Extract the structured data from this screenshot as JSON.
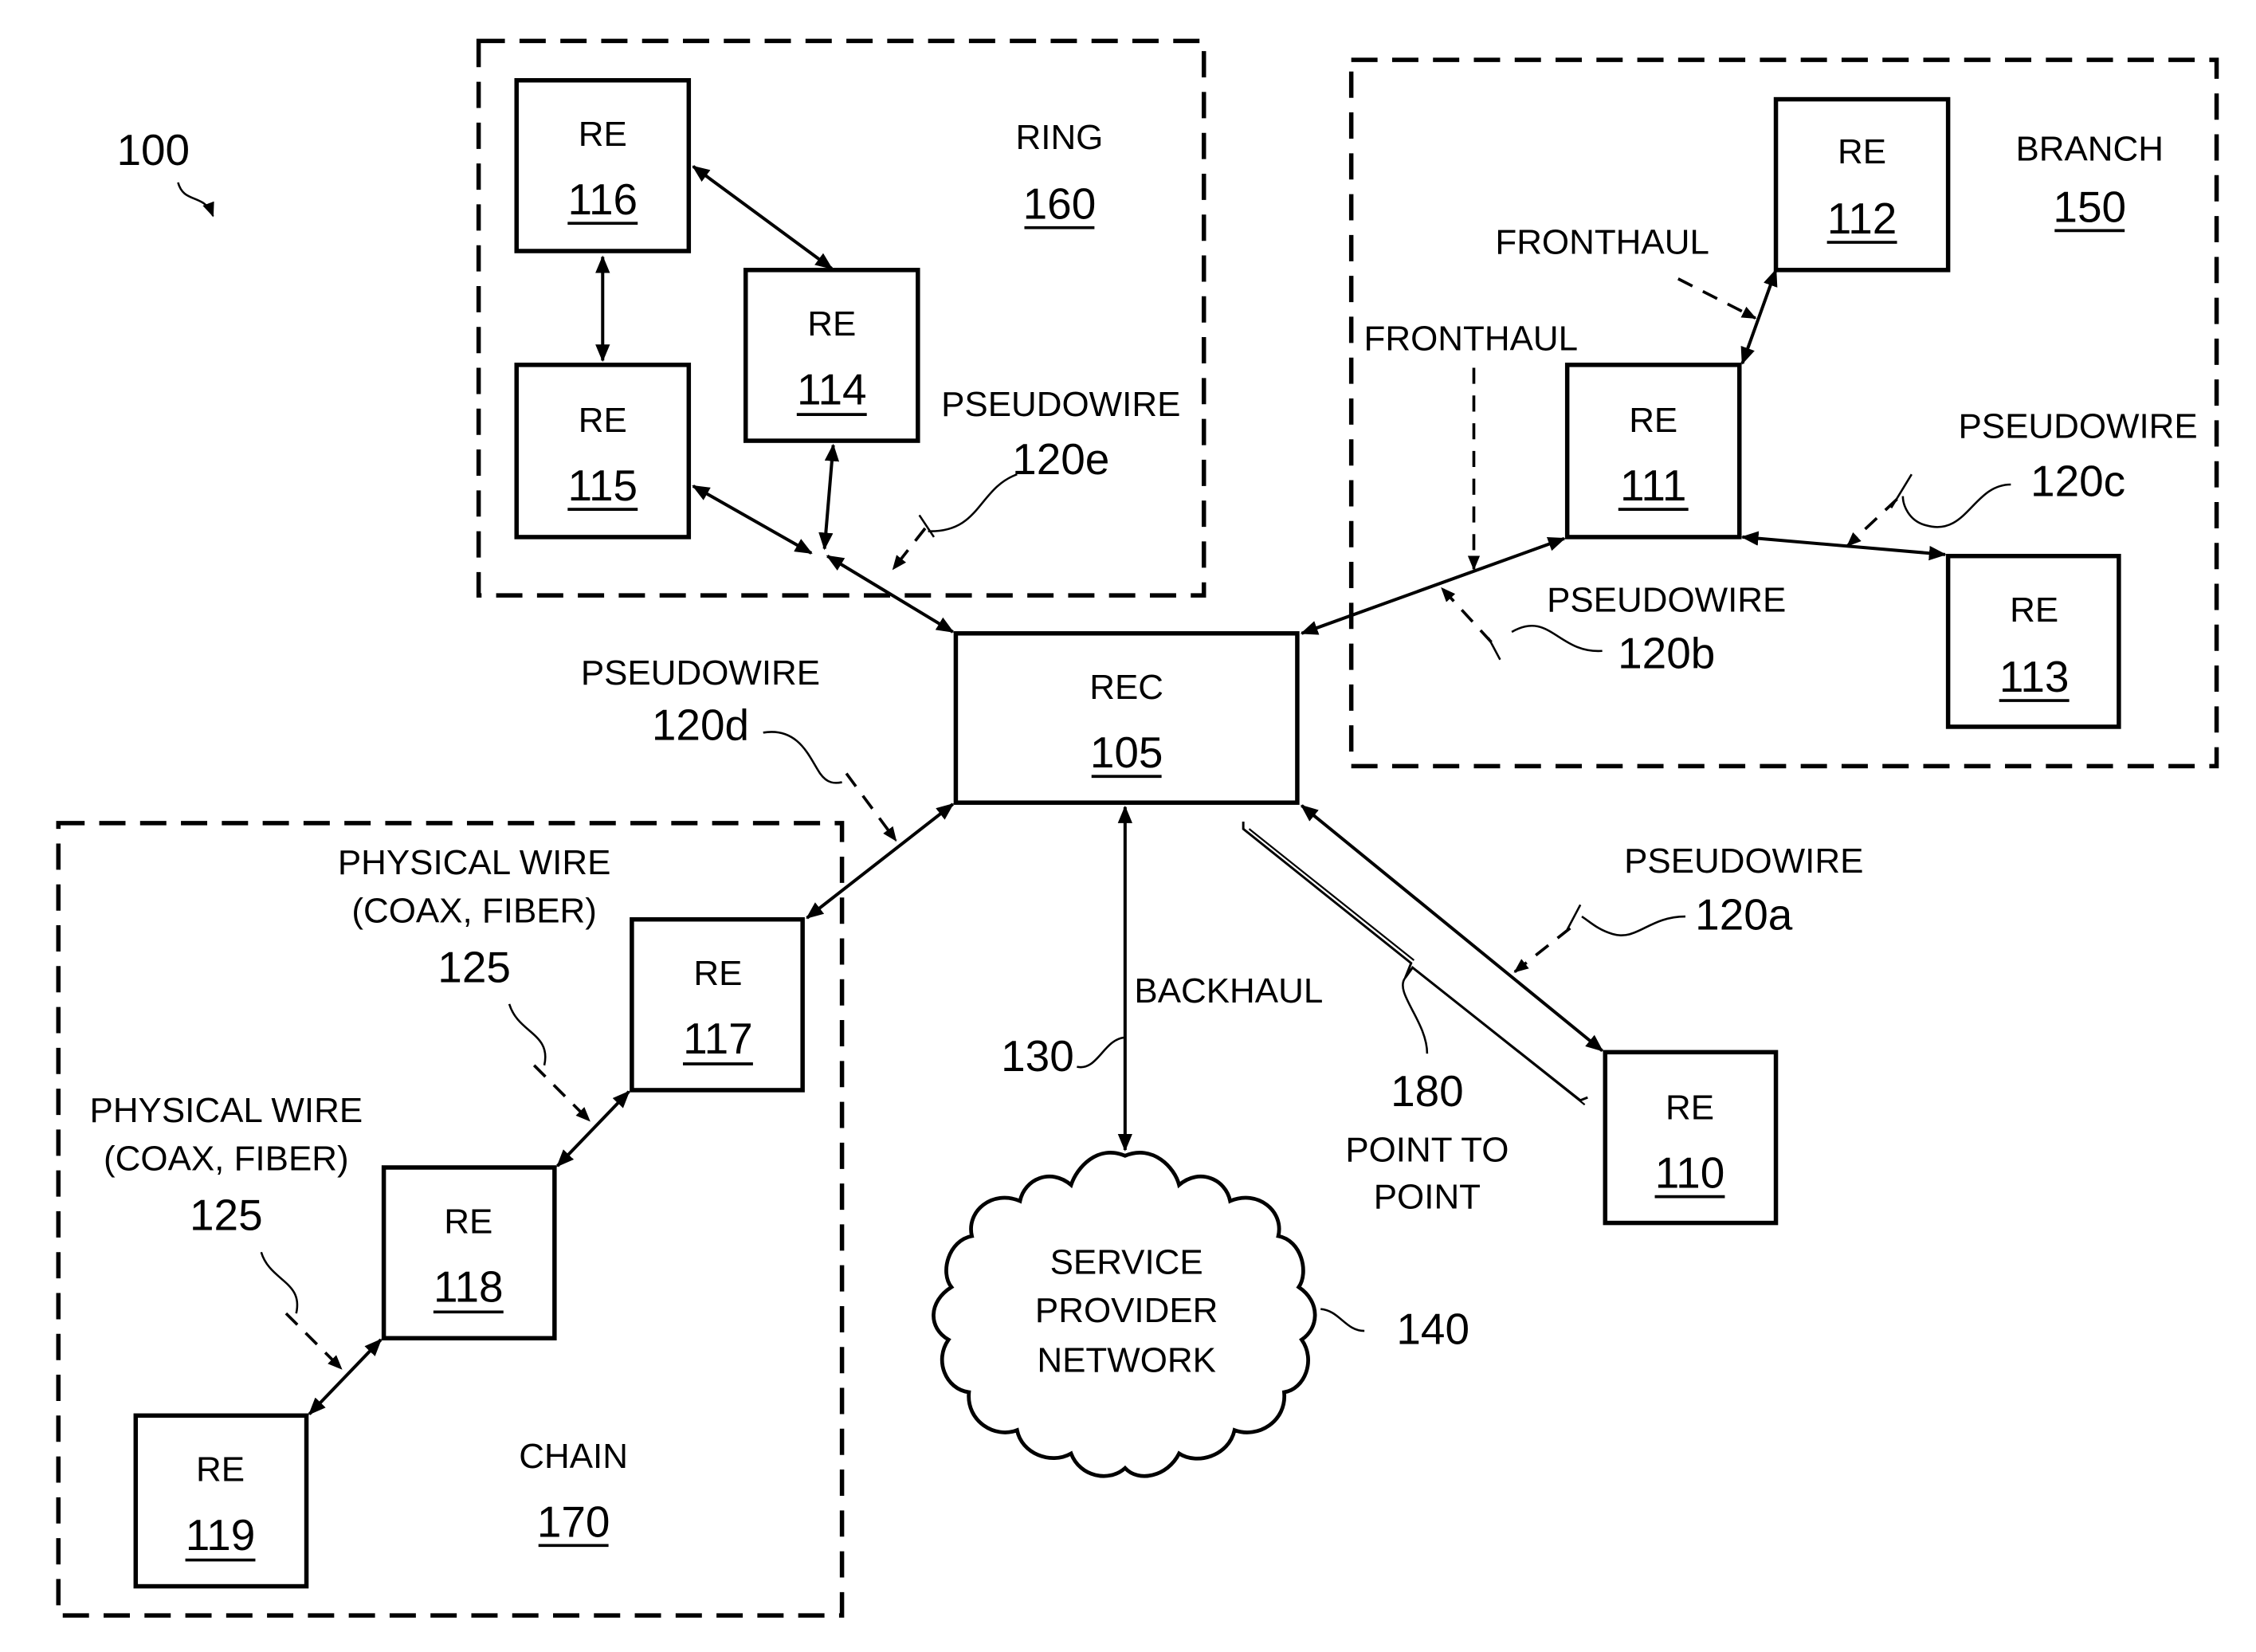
{
  "figure": {
    "ref": "100"
  },
  "groups": {
    "ring": {
      "label": "RING",
      "ref": "160"
    },
    "branch": {
      "label": "BRANCH",
      "ref": "150"
    },
    "chain": {
      "label": "CHAIN",
      "ref": "170"
    }
  },
  "nodes": {
    "rec": {
      "label": "REC",
      "ref": "105"
    },
    "re110": {
      "label": "RE",
      "ref": "110"
    },
    "re111": {
      "label": "RE",
      "ref": "111"
    },
    "re112": {
      "label": "RE",
      "ref": "112"
    },
    "re113": {
      "label": "RE",
      "ref": "113"
    },
    "re114": {
      "label": "RE",
      "ref": "114"
    },
    "re115": {
      "label": "RE",
      "ref": "115"
    },
    "re116": {
      "label": "RE",
      "ref": "116"
    },
    "re117": {
      "label": "RE",
      "ref": "117"
    },
    "re118": {
      "label": "RE",
      "ref": "118"
    },
    "re119": {
      "label": "RE",
      "ref": "119"
    }
  },
  "cloud": {
    "lines": [
      "SERVICE",
      "PROVIDER",
      "NETWORK"
    ],
    "ref": "140"
  },
  "links": {
    "pw_a": {
      "label": "PSEUDOWIRE",
      "ref": "120a"
    },
    "pw_b": {
      "label": "PSEUDOWIRE",
      "ref": "120b"
    },
    "pw_c": {
      "label": "PSEUDOWIRE",
      "ref": "120c"
    },
    "pw_d": {
      "label": "PSEUDOWIRE",
      "ref": "120d"
    },
    "pw_e": {
      "label": "PSEUDOWIRE",
      "ref": "120e"
    },
    "fronthaul_1": {
      "label": "FRONTHAUL"
    },
    "fronthaul_2": {
      "label": "FRONTHAUL"
    },
    "backhaul": {
      "label": "BACKHAUL",
      "ref": "130"
    },
    "physical_upper": {
      "line1": "PHYSICAL WIRE",
      "line2": "(COAX, FIBER)",
      "ref": "125"
    },
    "physical_lower": {
      "line1": "PHYSICAL WIRE",
      "line2": "(COAX, FIBER)",
      "ref": "125"
    },
    "p2p": {
      "ref": "180",
      "line1": "POINT TO",
      "line2": "POINT"
    }
  }
}
